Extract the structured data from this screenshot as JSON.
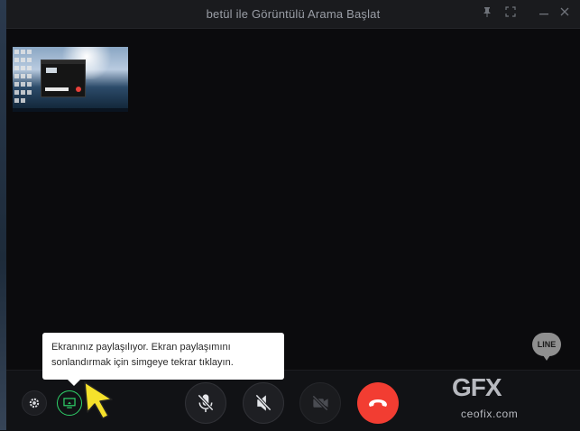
{
  "window": {
    "title": "betül ile Görüntülü Arama Başlat",
    "title_buttons": [
      "pin-icon",
      "expand-icon",
      "minimize-icon",
      "close-icon"
    ]
  },
  "video_area": {
    "self_preview": "screen-share-preview",
    "logo_text": "LINE"
  },
  "tooltip": {
    "line1": "Ekranınız paylaşılıyor. Ekran paylaşımını",
    "line2": "sonlandırmak için simgeye tekrar tıklayın."
  },
  "controls": {
    "settings_icon": "gear-icon",
    "share_icon": "screen-share-icon",
    "mic_icon": "microphone-icon",
    "speaker_icon": "speaker-muted-icon",
    "video_icon": "camera-off-icon",
    "end_call_icon": "phone-hangup-icon"
  },
  "watermark": {
    "logo": "GFX",
    "text": "ceofix.com"
  },
  "colors": {
    "window_bg": "#0b0b0d",
    "share_active": "#2fd36a",
    "end_call": "#f23d32",
    "cursor": "#f5e12b"
  }
}
